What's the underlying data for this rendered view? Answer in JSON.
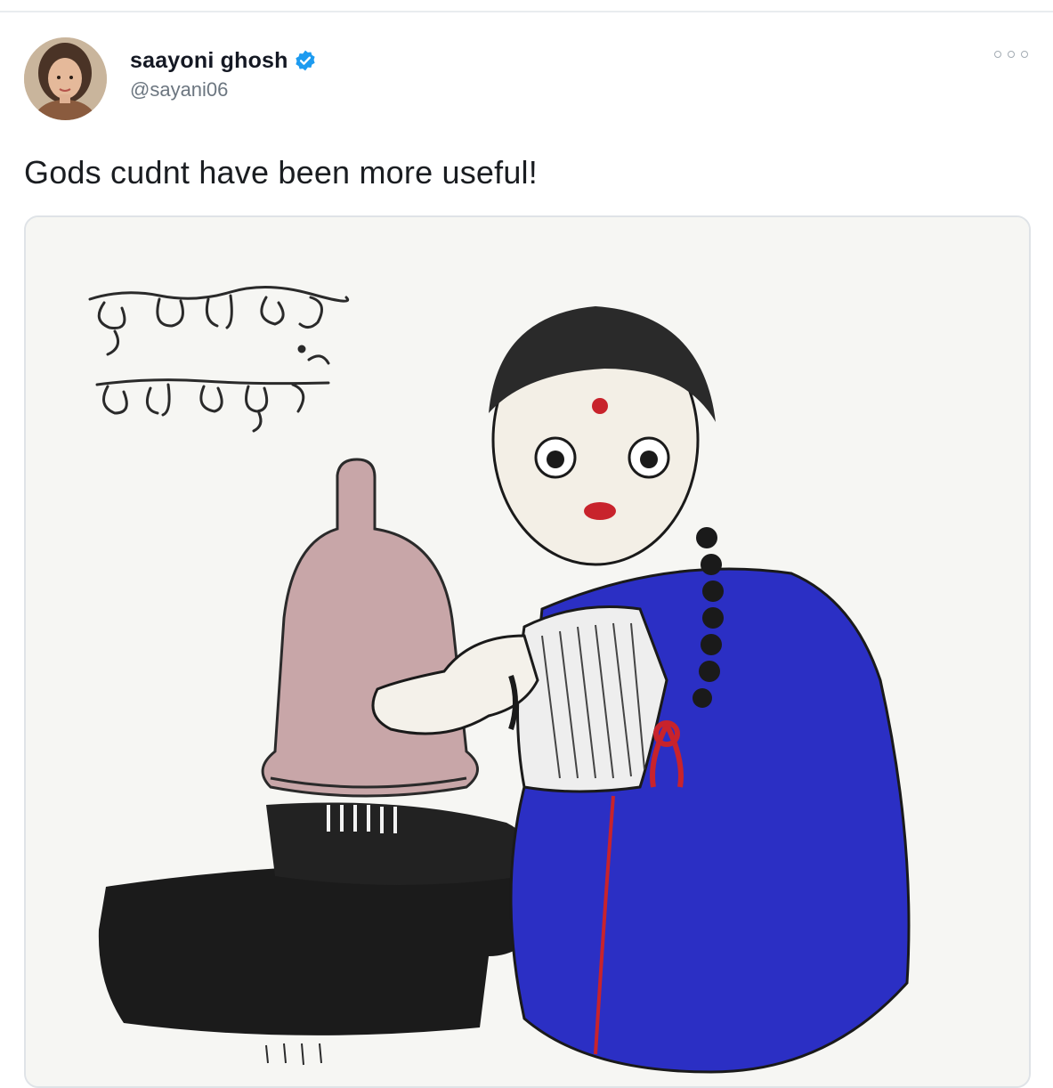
{
  "tweet": {
    "display_name": "saayoni ghosh",
    "handle": "@sayani06",
    "text": "Gods cudnt have been more useful!",
    "verified": true
  },
  "icons": {
    "verified": "verified-badge-icon",
    "more": "more-options-icon"
  },
  "colors": {
    "verified_blue": "#1d9bf0",
    "saree_blue": "#2b2fc4",
    "ribbon_red": "#c8232c"
  }
}
